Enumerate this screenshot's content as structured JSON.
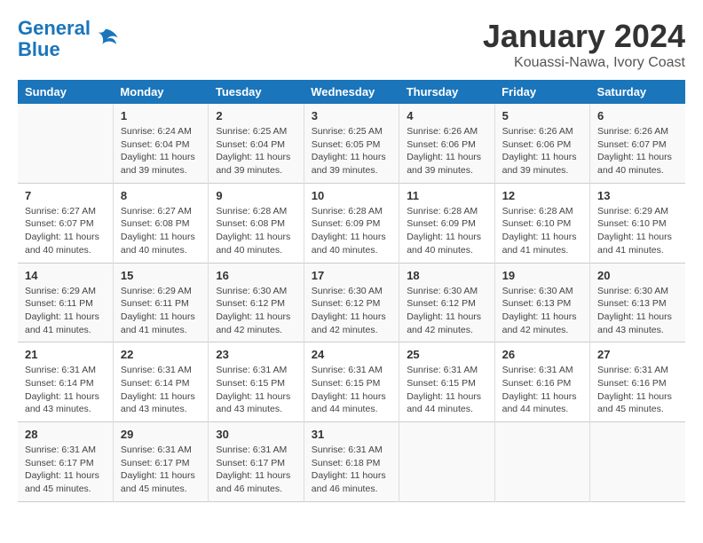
{
  "logo": {
    "line1": "General",
    "line2": "Blue"
  },
  "title": "January 2024",
  "subtitle": "Kouassi-Nawa, Ivory Coast",
  "headers": [
    "Sunday",
    "Monday",
    "Tuesday",
    "Wednesday",
    "Thursday",
    "Friday",
    "Saturday"
  ],
  "weeks": [
    [
      {
        "num": "",
        "info": ""
      },
      {
        "num": "1",
        "info": "Sunrise: 6:24 AM\nSunset: 6:04 PM\nDaylight: 11 hours\nand 39 minutes."
      },
      {
        "num": "2",
        "info": "Sunrise: 6:25 AM\nSunset: 6:04 PM\nDaylight: 11 hours\nand 39 minutes."
      },
      {
        "num": "3",
        "info": "Sunrise: 6:25 AM\nSunset: 6:05 PM\nDaylight: 11 hours\nand 39 minutes."
      },
      {
        "num": "4",
        "info": "Sunrise: 6:26 AM\nSunset: 6:06 PM\nDaylight: 11 hours\nand 39 minutes."
      },
      {
        "num": "5",
        "info": "Sunrise: 6:26 AM\nSunset: 6:06 PM\nDaylight: 11 hours\nand 39 minutes."
      },
      {
        "num": "6",
        "info": "Sunrise: 6:26 AM\nSunset: 6:07 PM\nDaylight: 11 hours\nand 40 minutes."
      }
    ],
    [
      {
        "num": "7",
        "info": "Sunrise: 6:27 AM\nSunset: 6:07 PM\nDaylight: 11 hours\nand 40 minutes."
      },
      {
        "num": "8",
        "info": "Sunrise: 6:27 AM\nSunset: 6:08 PM\nDaylight: 11 hours\nand 40 minutes."
      },
      {
        "num": "9",
        "info": "Sunrise: 6:28 AM\nSunset: 6:08 PM\nDaylight: 11 hours\nand 40 minutes."
      },
      {
        "num": "10",
        "info": "Sunrise: 6:28 AM\nSunset: 6:09 PM\nDaylight: 11 hours\nand 40 minutes."
      },
      {
        "num": "11",
        "info": "Sunrise: 6:28 AM\nSunset: 6:09 PM\nDaylight: 11 hours\nand 40 minutes."
      },
      {
        "num": "12",
        "info": "Sunrise: 6:28 AM\nSunset: 6:10 PM\nDaylight: 11 hours\nand 41 minutes."
      },
      {
        "num": "13",
        "info": "Sunrise: 6:29 AM\nSunset: 6:10 PM\nDaylight: 11 hours\nand 41 minutes."
      }
    ],
    [
      {
        "num": "14",
        "info": "Sunrise: 6:29 AM\nSunset: 6:11 PM\nDaylight: 11 hours\nand 41 minutes."
      },
      {
        "num": "15",
        "info": "Sunrise: 6:29 AM\nSunset: 6:11 PM\nDaylight: 11 hours\nand 41 minutes."
      },
      {
        "num": "16",
        "info": "Sunrise: 6:30 AM\nSunset: 6:12 PM\nDaylight: 11 hours\nand 42 minutes."
      },
      {
        "num": "17",
        "info": "Sunrise: 6:30 AM\nSunset: 6:12 PM\nDaylight: 11 hours\nand 42 minutes."
      },
      {
        "num": "18",
        "info": "Sunrise: 6:30 AM\nSunset: 6:12 PM\nDaylight: 11 hours\nand 42 minutes."
      },
      {
        "num": "19",
        "info": "Sunrise: 6:30 AM\nSunset: 6:13 PM\nDaylight: 11 hours\nand 42 minutes."
      },
      {
        "num": "20",
        "info": "Sunrise: 6:30 AM\nSunset: 6:13 PM\nDaylight: 11 hours\nand 43 minutes."
      }
    ],
    [
      {
        "num": "21",
        "info": "Sunrise: 6:31 AM\nSunset: 6:14 PM\nDaylight: 11 hours\nand 43 minutes."
      },
      {
        "num": "22",
        "info": "Sunrise: 6:31 AM\nSunset: 6:14 PM\nDaylight: 11 hours\nand 43 minutes."
      },
      {
        "num": "23",
        "info": "Sunrise: 6:31 AM\nSunset: 6:15 PM\nDaylight: 11 hours\nand 43 minutes."
      },
      {
        "num": "24",
        "info": "Sunrise: 6:31 AM\nSunset: 6:15 PM\nDaylight: 11 hours\nand 44 minutes."
      },
      {
        "num": "25",
        "info": "Sunrise: 6:31 AM\nSunset: 6:15 PM\nDaylight: 11 hours\nand 44 minutes."
      },
      {
        "num": "26",
        "info": "Sunrise: 6:31 AM\nSunset: 6:16 PM\nDaylight: 11 hours\nand 44 minutes."
      },
      {
        "num": "27",
        "info": "Sunrise: 6:31 AM\nSunset: 6:16 PM\nDaylight: 11 hours\nand 45 minutes."
      }
    ],
    [
      {
        "num": "28",
        "info": "Sunrise: 6:31 AM\nSunset: 6:17 PM\nDaylight: 11 hours\nand 45 minutes."
      },
      {
        "num": "29",
        "info": "Sunrise: 6:31 AM\nSunset: 6:17 PM\nDaylight: 11 hours\nand 45 minutes."
      },
      {
        "num": "30",
        "info": "Sunrise: 6:31 AM\nSunset: 6:17 PM\nDaylight: 11 hours\nand 46 minutes."
      },
      {
        "num": "31",
        "info": "Sunrise: 6:31 AM\nSunset: 6:18 PM\nDaylight: 11 hours\nand 46 minutes."
      },
      {
        "num": "",
        "info": ""
      },
      {
        "num": "",
        "info": ""
      },
      {
        "num": "",
        "info": ""
      }
    ]
  ]
}
